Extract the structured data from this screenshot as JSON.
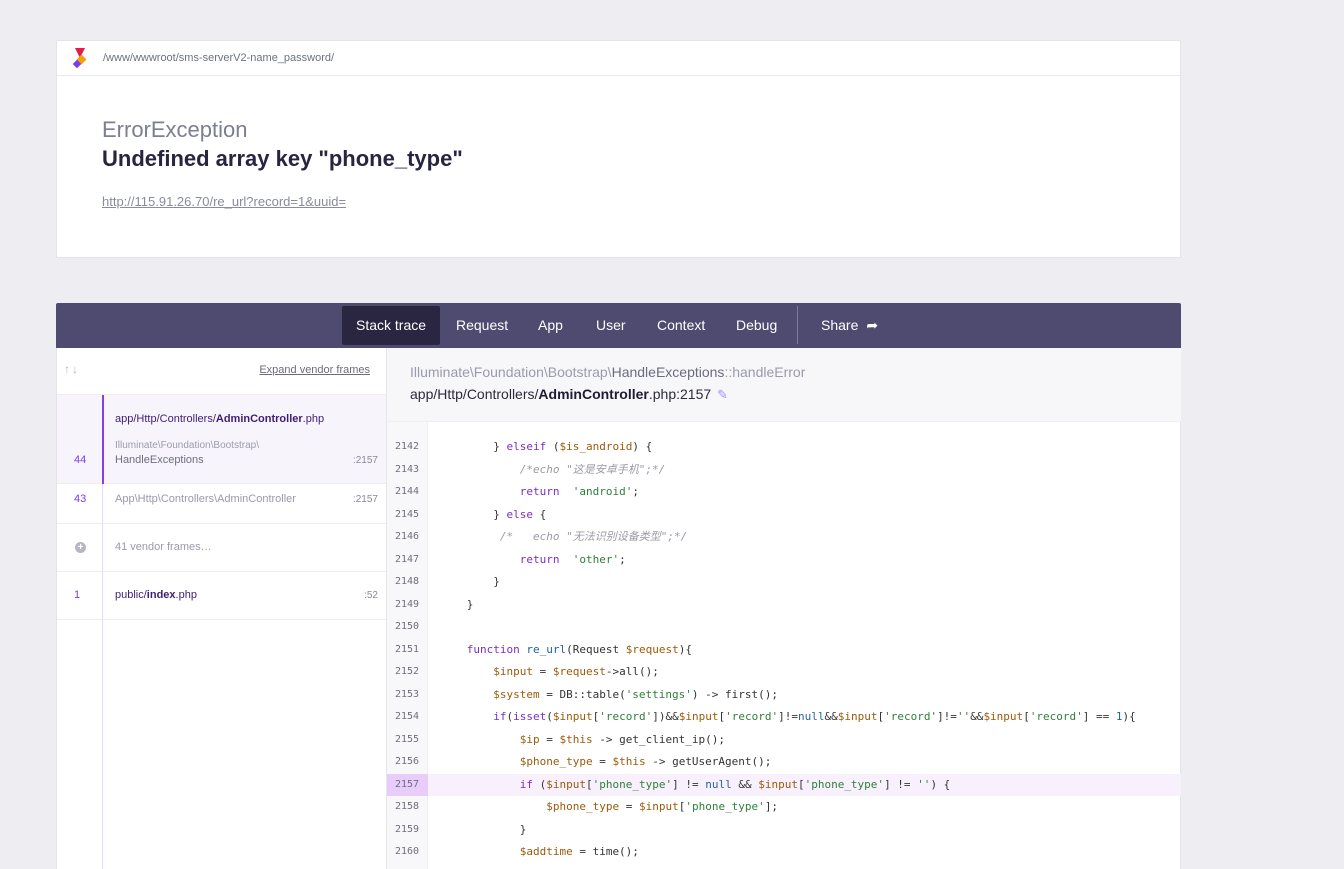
{
  "header": {
    "path": "/www/wwwroot/sms-serverV2-name_password/",
    "exception_class": "ErrorException",
    "message": "Undefined array key \"phone_type\"",
    "url": "http://115.91.26.70/re_url?record=1&uuid="
  },
  "tabs": {
    "stack_trace": "Stack trace",
    "request": "Request",
    "app": "App",
    "user": "User",
    "context": "Context",
    "debug": "Debug",
    "share": "Share"
  },
  "frames": {
    "expand_label": "Expand vendor frames",
    "selected": {
      "file_prefix": "app/Http/Controllers/",
      "file_name": "AdminController",
      "file_ext": ".php",
      "number": "44",
      "class_line1": "Illuminate\\Foundation\\Bootstrap\\",
      "class_line2": "HandleExceptions",
      "line": ":2157"
    },
    "row43": {
      "number": "43",
      "text": "App\\Http\\Controllers\\AdminController",
      "line": ":2157"
    },
    "vendor": {
      "text": "41 vendor frames…"
    },
    "row1": {
      "number": "1",
      "file_prefix": "public/",
      "file_name": "index",
      "file_ext": ".php",
      "line": ":52"
    }
  },
  "source": {
    "class_prefix": "Illuminate\\Foundation\\Bootstrap\\",
    "class_name": "HandleExceptions",
    "method": "::handleError",
    "file_prefix": "app/Http/Controllers/",
    "file_name": "AdminController",
    "file_suffix": ".php:2157"
  },
  "code_lines": [
    "2142",
    "2143",
    "2144",
    "2145",
    "2146",
    "2147",
    "2148",
    "2149",
    "2150",
    "2151",
    "2152",
    "2153",
    "2154",
    "2155",
    "2156",
    "2157",
    "2158",
    "2159",
    "2160"
  ],
  "highlighted_line": "2157",
  "colors": {
    "accent": "#7c3aed",
    "tabbar": "#4f4a6f",
    "tab_active": "#2a2541"
  }
}
